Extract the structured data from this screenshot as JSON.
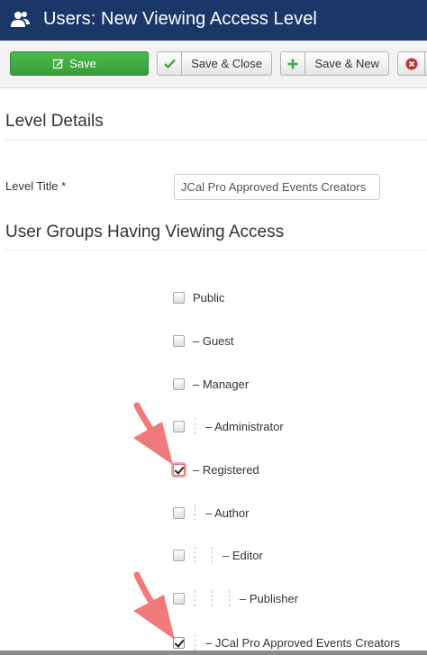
{
  "header": {
    "title": "Users: New Viewing Access Level",
    "icon": "users-icon"
  },
  "toolbar": {
    "save_label": "Save",
    "save_close_label": "Save & Close",
    "save_new_label": "Save & New",
    "colors": {
      "save_bg": "#46a546",
      "header_bg": "#1a3867"
    }
  },
  "level_details": {
    "heading": "Level Details",
    "title_label": "Level Title *",
    "title_value": "JCal Pro Approved Events Creators"
  },
  "groups": {
    "heading": "User Groups Having Viewing Access",
    "items": [
      {
        "label": "Public",
        "depth": 0,
        "checked": false
      },
      {
        "label": "– Guest",
        "depth": 0,
        "checked": false
      },
      {
        "label": "– Manager",
        "depth": 0,
        "checked": false
      },
      {
        "label": "– Administrator",
        "depth": 1,
        "checked": false
      },
      {
        "label": "– Registered",
        "depth": 0,
        "checked": true
      },
      {
        "label": "– Author",
        "depth": 1,
        "checked": false
      },
      {
        "label": "– Editor",
        "depth": 2,
        "checked": false
      },
      {
        "label": "– Publisher",
        "depth": 3,
        "checked": false
      },
      {
        "label": "– JCal Pro Approved Events Creators",
        "depth": 1,
        "checked": true
      }
    ]
  },
  "annotation": {
    "arrow_color": "#f07a7a"
  }
}
